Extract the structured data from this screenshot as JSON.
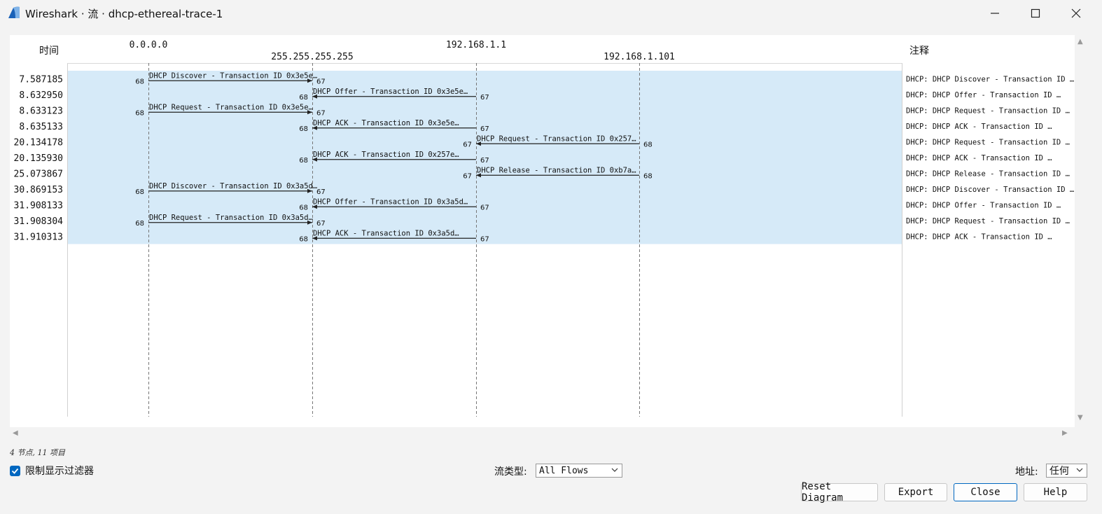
{
  "window": {
    "title": "Wireshark · 流 · dhcp-ethereal-trace-1"
  },
  "diagram": {
    "time_header": "时间",
    "comment_header": "注释",
    "nodes": [
      {
        "address": "0.0.0.0",
        "label_row": 0
      },
      {
        "address": "255.255.255.255",
        "label_row": 1
      },
      {
        "address": "192.168.1.1",
        "label_row": 0
      },
      {
        "address": "192.168.1.101",
        "label_row": 1
      }
    ],
    "flows": [
      {
        "time": "7.587185",
        "from": 0,
        "to": 1,
        "src_port": "68",
        "dst_port": "67",
        "label": "DHCP Discover - Transaction ID 0x3e5e…",
        "comment": "DHCP: DHCP Discover - Transaction ID …"
      },
      {
        "time": "8.632950",
        "from": 2,
        "to": 1,
        "src_port": "67",
        "dst_port": "68",
        "label": "DHCP Offer    - Transaction ID 0x3e5e…",
        "comment": "DHCP: DHCP Offer    - Transaction ID …"
      },
      {
        "time": "8.633123",
        "from": 0,
        "to": 1,
        "src_port": "68",
        "dst_port": "67",
        "label": "DHCP Request  - Transaction ID 0x3e5e…",
        "comment": "DHCP: DHCP Request  - Transaction ID …"
      },
      {
        "time": "8.635133",
        "from": 2,
        "to": 1,
        "src_port": "67",
        "dst_port": "68",
        "label": "DHCP ACK      - Transaction ID 0x3e5e…",
        "comment": "DHCP: DHCP ACK      - Transaction ID …"
      },
      {
        "time": "20.134178",
        "from": 3,
        "to": 2,
        "src_port": "68",
        "dst_port": "67",
        "label": "DHCP Request  - Transaction ID 0x257…",
        "comment": "DHCP: DHCP Request  - Transaction ID …"
      },
      {
        "time": "20.135930",
        "from": 2,
        "to": 1,
        "src_port": "67",
        "dst_port": "68",
        "label": "DHCP ACK      - Transaction ID 0x257e…",
        "comment": "DHCP: DHCP ACK      - Transaction ID …"
      },
      {
        "time": "25.073867",
        "from": 3,
        "to": 2,
        "src_port": "68",
        "dst_port": "67",
        "label": "DHCP Release  - Transaction ID 0xb7a…",
        "comment": "DHCP: DHCP Release  - Transaction ID …"
      },
      {
        "time": "30.869153",
        "from": 0,
        "to": 1,
        "src_port": "68",
        "dst_port": "67",
        "label": "DHCP Discover - Transaction ID 0x3a5d…",
        "comment": "DHCP: DHCP Discover - Transaction ID …"
      },
      {
        "time": "31.908133",
        "from": 2,
        "to": 1,
        "src_port": "67",
        "dst_port": "68",
        "label": "DHCP Offer    - Transaction ID 0x3a5d…",
        "comment": "DHCP: DHCP Offer    - Transaction ID …"
      },
      {
        "time": "31.908304",
        "from": 0,
        "to": 1,
        "src_port": "68",
        "dst_port": "67",
        "label": "DHCP Request  - Transaction ID 0x3a5d…",
        "comment": "DHCP: DHCP Request  - Transaction ID …"
      },
      {
        "time": "31.910313",
        "from": 2,
        "to": 1,
        "src_port": "67",
        "dst_port": "68",
        "label": "DHCP ACK      - Transaction ID 0x3a5d…",
        "comment": "DHCP: DHCP ACK      - Transaction ID …"
      }
    ],
    "highlight_color": "#d6eaf8"
  },
  "status": {
    "summary": "4 节点, 11 项目"
  },
  "options": {
    "limit_filter_label": "限制显示过滤器",
    "limit_filter_checked": true,
    "flow_type_label": "流类型:",
    "flow_type_value": "All Flows",
    "address_label": "地址:",
    "address_value": "任何"
  },
  "buttons": {
    "reset": "Reset Diagram",
    "export": "Export",
    "close": "Close",
    "help": "Help"
  },
  "colors": {
    "accent": "#0067c0"
  }
}
